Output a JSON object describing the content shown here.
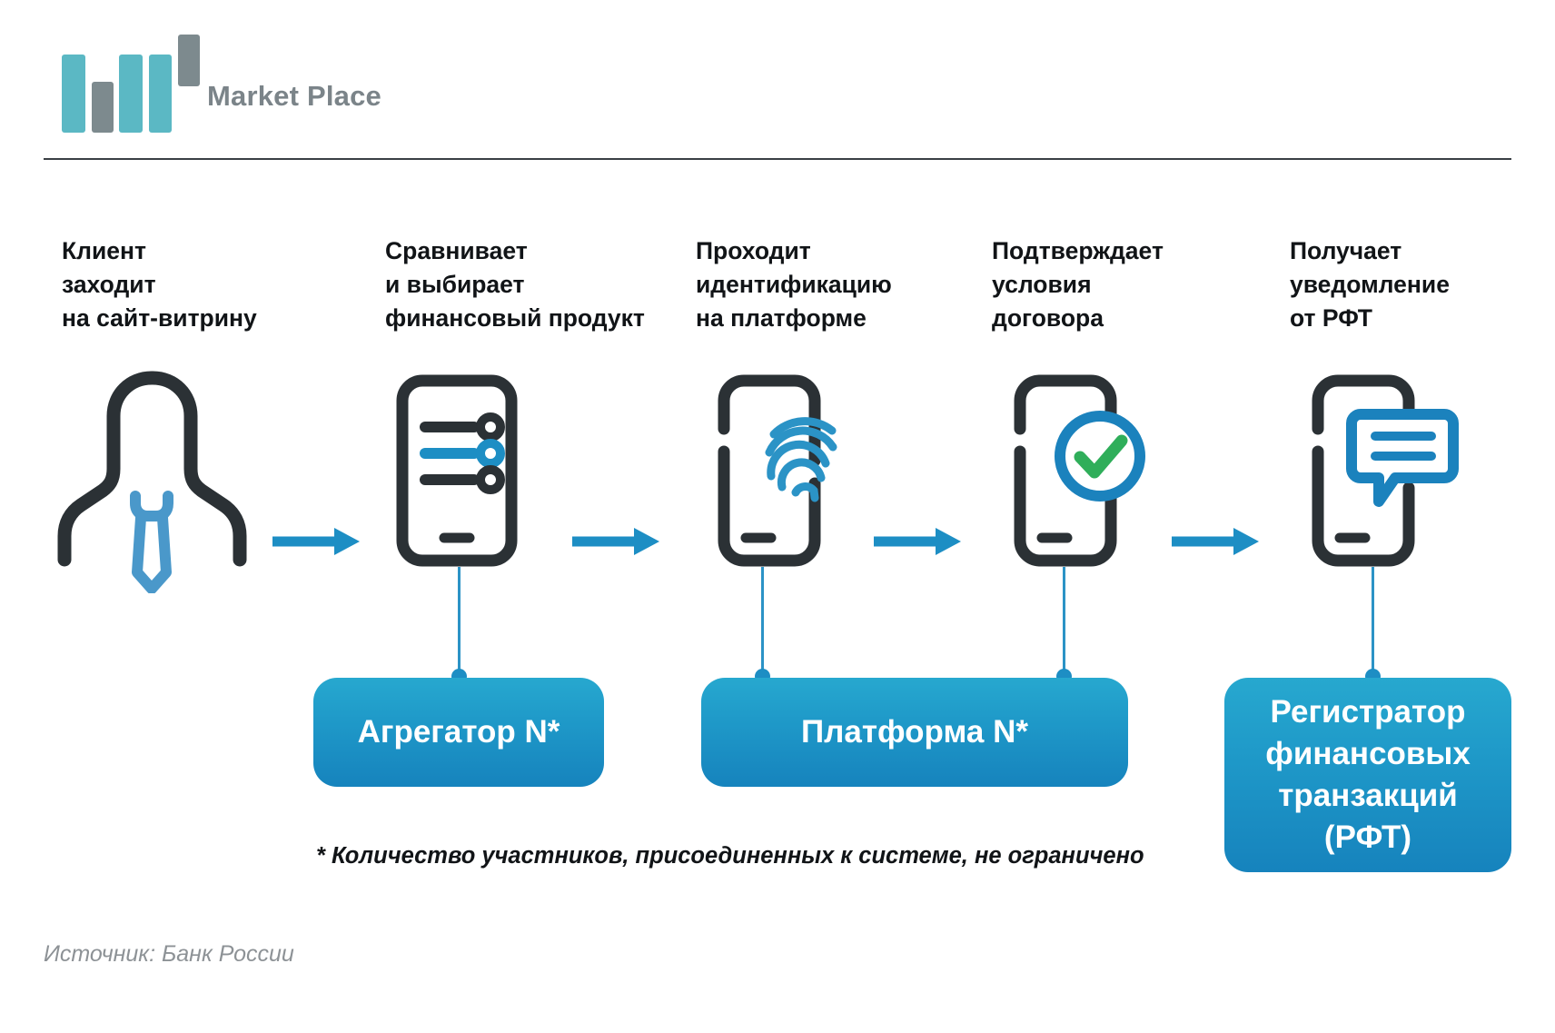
{
  "brand": {
    "name": "Market Place",
    "logo_colors": {
      "teal": "#5bb8c4",
      "gray": "#7d8a8e"
    }
  },
  "colors": {
    "dark": "#2b3135",
    "blue": "#1d8ec4",
    "blue_dark": "#1683bd",
    "blue_light": "#27a8cf",
    "green": "#2fae5a",
    "gray_text": "#8d9296"
  },
  "steps": [
    {
      "id": "client",
      "caption": "Клиент\nзаходит\nна сайт-витрину",
      "icon": "person-with-tie-icon"
    },
    {
      "id": "compare",
      "caption": "Сравнивает\nи выбирает\nфинансовый продукт",
      "icon": "phone-list-icon"
    },
    {
      "id": "identify",
      "caption": "Проходит\nидентификацию\nна платформе",
      "icon": "phone-fingerprint-icon"
    },
    {
      "id": "confirm",
      "caption": "Подтверждает\nусловия\nдоговора",
      "icon": "phone-check-icon"
    },
    {
      "id": "notify",
      "caption": "Получает\nуведомление\nот РФТ",
      "icon": "phone-message-icon"
    }
  ],
  "arrows": {
    "count": 4,
    "name": "flow-arrow"
  },
  "boxes": [
    {
      "id": "aggregator",
      "label": "Агрегатор N*"
    },
    {
      "id": "platform",
      "label": "Платформа N*"
    },
    {
      "id": "registrar",
      "label": "Регистратор\nфинансовых\nтранзакций\n(РФТ)"
    }
  ],
  "footnote": "* Количество участников, присоединенных к системе, не ограничено",
  "source": "Источник: Банк России"
}
